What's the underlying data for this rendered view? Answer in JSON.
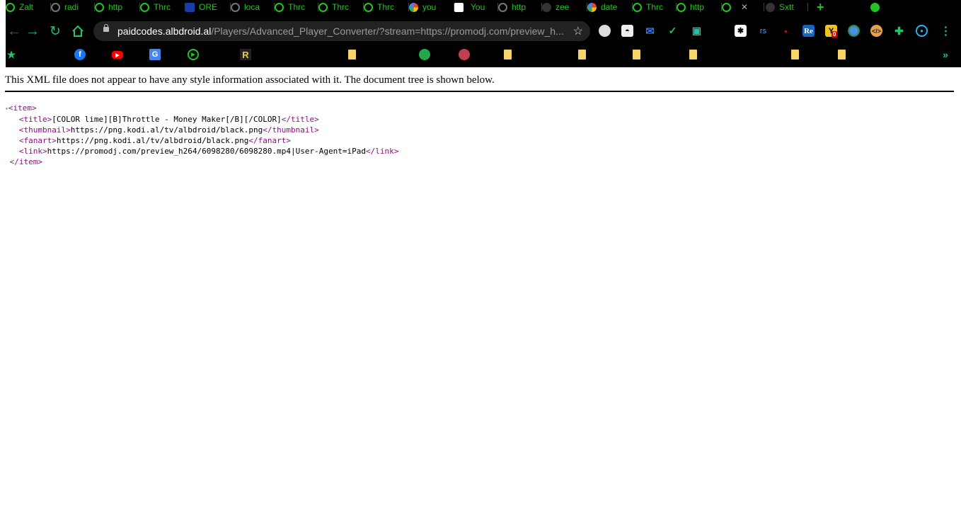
{
  "tabs": [
    {
      "title": "Zalt",
      "icon": "play-icon"
    },
    {
      "title": "radi",
      "icon": "globe-icon"
    },
    {
      "title": "http",
      "icon": "play-icon"
    },
    {
      "title": "Thrc",
      "icon": "play-icon"
    },
    {
      "title": "ORE",
      "icon": "google-cloud-icon"
    },
    {
      "title": "loca",
      "icon": "globe-icon"
    },
    {
      "title": "Thrc",
      "icon": "play-icon"
    },
    {
      "title": "Thrc",
      "icon": "play-icon"
    },
    {
      "title": "Thrc",
      "icon": "play-icon"
    },
    {
      "title": "you",
      "icon": "google-icon"
    },
    {
      "title": "You",
      "icon": "blank-page-icon"
    },
    {
      "title": "http",
      "icon": "globe-icon"
    },
    {
      "title": "zee",
      "icon": "github-icon"
    },
    {
      "title": "date",
      "icon": "google-icon"
    },
    {
      "title": "Thrc",
      "icon": "play-icon"
    },
    {
      "title": "http",
      "icon": "play-icon"
    },
    {
      "title": "Sxtt",
      "icon": "github-icon"
    }
  ],
  "omnibox": {
    "host": "paidcodes.albdroid.al",
    "path": "/Players/Advanced_Player_Converter/?stream=https://promodj.com/preview_h..."
  },
  "extensions": [
    {
      "icon": "globe-ext-icon",
      "label": ""
    },
    {
      "icon": "incognito-ext-icon",
      "label": ""
    },
    {
      "icon": "mail-ext-icon",
      "label": ""
    },
    {
      "icon": "check-ext-icon",
      "label": ""
    },
    {
      "icon": "android-ext-icon",
      "label": ""
    },
    {
      "icon": "asterisk-ext-icon",
      "label": "✱"
    },
    {
      "icon": "rs-ext-icon",
      "label": "rs"
    },
    {
      "icon": "red-dot-ext-icon",
      "label": ""
    },
    {
      "icon": "re-ext-icon",
      "label": "Re"
    },
    {
      "icon": "y-ext-icon",
      "label": "Y",
      "badge": "0"
    },
    {
      "icon": "earth-ext-icon",
      "label": ""
    },
    {
      "icon": "code-ext-icon",
      "label": ""
    },
    {
      "icon": "puzzle-icon",
      "label": ""
    },
    {
      "icon": "target-ext-icon",
      "label": ""
    }
  ],
  "bookmarks": [
    {
      "icon": "bookmarks-star-icon"
    },
    {
      "icon": "facebook-icon",
      "label": "f"
    },
    {
      "icon": "youtube-icon"
    },
    {
      "icon": "google-translate-icon",
      "label": "G"
    },
    {
      "icon": "play-icon"
    },
    {
      "icon": "r-logo-icon",
      "label": "R"
    },
    {
      "icon": "folder-icon"
    },
    {
      "icon": "globe-icon"
    },
    {
      "icon": "rose-icon"
    },
    {
      "icon": "folder-icon"
    },
    {
      "icon": "folder-icon"
    },
    {
      "icon": "folder-icon"
    },
    {
      "icon": "folder-icon"
    },
    {
      "icon": "folder-icon"
    },
    {
      "icon": "folder-icon"
    }
  ],
  "more_bookmarks": "»",
  "info_text": "This XML file does not appear to have any style information associated with it. The document tree is shown below.",
  "xml": {
    "open_item": "<item>",
    "lines": [
      {
        "open": "<title>",
        "text": "[COLOR lime][B]Throttle - Money Maker[/B][/COLOR]",
        "close": "</title>"
      },
      {
        "open": "<thumbnail>",
        "text": "https://png.kodi.al/tv/albdroid/black.png",
        "close": "</thumbnail>"
      },
      {
        "open": "<fanart>",
        "text": "https://png.kodi.al/tv/albdroid/black.png",
        "close": "</fanart>"
      },
      {
        "open": "<link>",
        "text": "https://promodj.com/preview_h264/6098280/6098280.mp4|User-Agent=iPad",
        "close": "</link>"
      }
    ],
    "close_item": "</item>"
  }
}
